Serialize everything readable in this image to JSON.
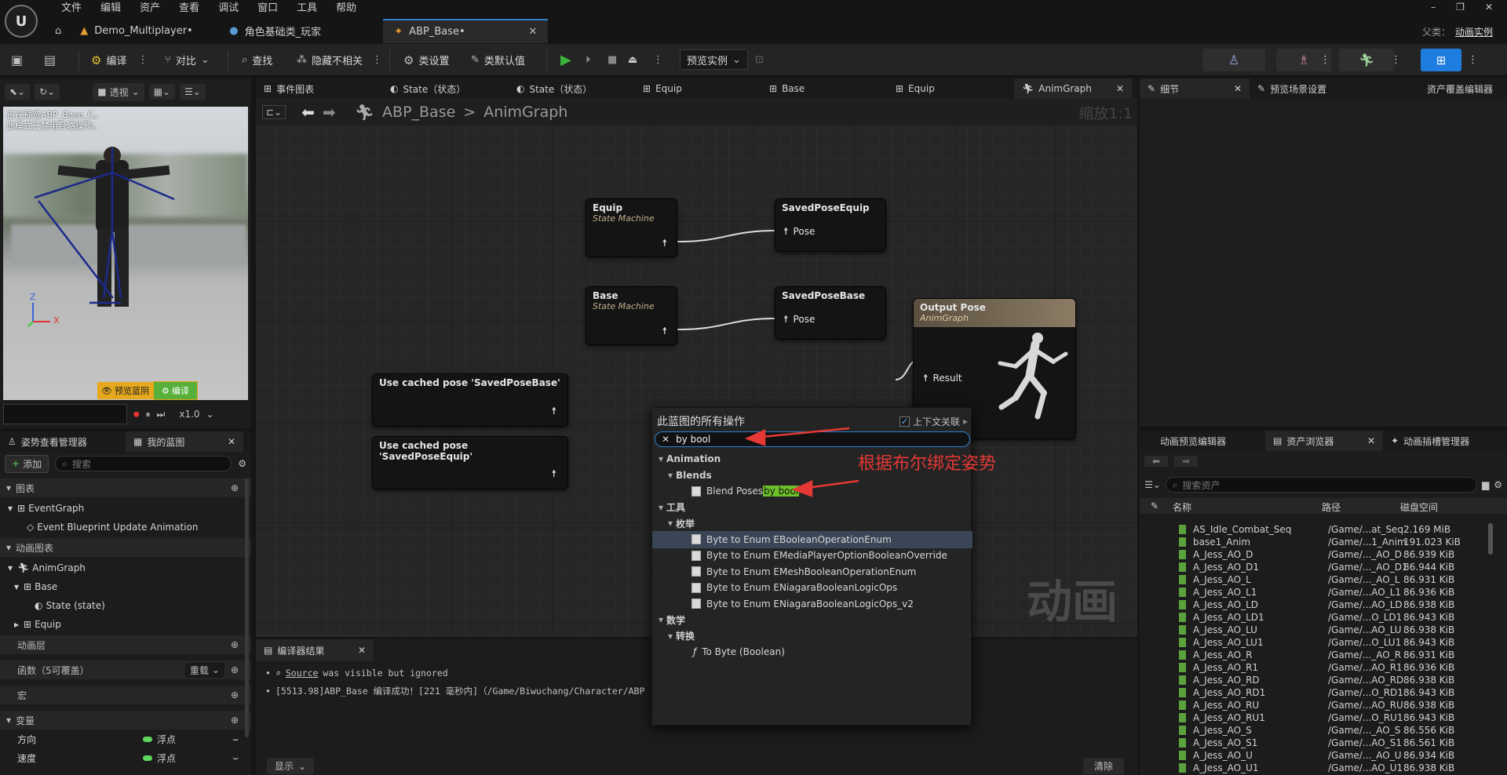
{
  "menu": [
    "文件",
    "编辑",
    "资产",
    "查看",
    "调试",
    "窗口",
    "工具",
    "帮助"
  ],
  "doc_tabs": [
    {
      "label": "Demo_Multiplayer•"
    },
    {
      "label": "角色基础类_玩家"
    },
    {
      "label": "ABP_Base•"
    }
  ],
  "top_right": {
    "parent_label": "父类：",
    "parent_value": "动画实例"
  },
  "toolbar": {
    "compile": "编译",
    "diff": "对比",
    "find": "查找",
    "hide_unrelated": "隐藏不相关",
    "class_settings": "类设置",
    "class_defaults": "类默认值",
    "preview_instance": "预览实例"
  },
  "viewport": {
    "mode": "透视",
    "notice_line1": "正在预览ABP_Base_C。",
    "notice_line2": "此模式已禁用骨骼操作。",
    "preview_btn": "预览蓝阴",
    "compile_btn": "编译",
    "speed": "x1.0",
    "axis_z": "Z",
    "axis_x": "X"
  },
  "left_tabs": {
    "pose_watch": "姿势查看管理器",
    "my_blueprint": "我的蓝图"
  },
  "my_bp": {
    "add": "添加",
    "search_placeholder": "搜索",
    "graphs": "图表",
    "event_graph": "EventGraph",
    "event_update": "Event Blueprint Update Animation",
    "anim_graphs": "动画图表",
    "anim_graph": "AnimGraph",
    "base": "Base",
    "state": "State (state)",
    "equip": "Equip",
    "anim_layers": "动画层",
    "functions": "函数（5可覆盖）",
    "override": "重载",
    "macros": "宏",
    "variables": "变量",
    "var1": "方向",
    "var2": "速度",
    "var_type": "浮点"
  },
  "graph_tabs": [
    {
      "label": "事件图表"
    },
    {
      "label": "State（状态）"
    },
    {
      "label": "State（状态）"
    },
    {
      "label": "Equip"
    },
    {
      "label": "Base"
    },
    {
      "label": "Equip"
    },
    {
      "label": "AnimGraph"
    }
  ],
  "breadcrumb": {
    "root": "ABP_Base",
    "sep": ">",
    "leaf": "AnimGraph",
    "zoom": "缩放1:1"
  },
  "nodes": {
    "equip_title": "Equip",
    "equip_sub": "State Machine",
    "saved_equip": "SavedPoseEquip",
    "pose": "Pose",
    "base_title": "Base",
    "base_sub": "State Machine",
    "saved_base": "SavedPoseBase",
    "output_title": "Output Pose",
    "output_sub": "AnimGraph",
    "result": "Result",
    "cached_base": "Use cached pose 'SavedPoseBase'",
    "cached_equip": "Use cached pose 'SavedPoseEquip'"
  },
  "watermark": "动画",
  "popup": {
    "title": "此蓝图的所有操作",
    "context": "上下文关联",
    "search_value": "by bool",
    "annotation": "根据布尔绑定姿势",
    "items": [
      {
        "label": "Animation",
        "indent": 0,
        "type": "hdr"
      },
      {
        "label": "Blends",
        "indent": 1,
        "type": "hdr"
      },
      {
        "label": "Blend Poses ",
        "hl": "by bool",
        "indent": 2,
        "type": "item"
      },
      {
        "label": "工具",
        "indent": 0,
        "type": "hdr"
      },
      {
        "label": "枚举",
        "indent": 1,
        "type": "hdr"
      },
      {
        "label": "Byte to Enum EBooleanOperationEnum",
        "indent": 2,
        "type": "item",
        "selected": true
      },
      {
        "label": "Byte to Enum EMediaPlayerOptionBooleanOverride",
        "indent": 2,
        "type": "item"
      },
      {
        "label": "Byte to Enum EMeshBooleanOperationEnum",
        "indent": 2,
        "type": "item"
      },
      {
        "label": "Byte to Enum ENiagaraBooleanLogicOps",
        "indent": 2,
        "type": "item"
      },
      {
        "label": "Byte to Enum ENiagaraBooleanLogicOps_v2",
        "indent": 2,
        "type": "item"
      },
      {
        "label": "数学",
        "indent": 0,
        "type": "hdr"
      },
      {
        "label": "转换",
        "indent": 1,
        "type": "hdr"
      },
      {
        "label": "To Byte (Boolean)",
        "indent": 2,
        "type": "func"
      }
    ]
  },
  "compiler": {
    "tab": "编译器结果",
    "line1_link": "Source",
    "line1_rest": " was visible but ignored",
    "line2": "[5513.98]ABP_Base 编译成功！[221 毫秒内]（/Game/Biwuchang/Character/ABP",
    "show": "显示",
    "clear": "清除"
  },
  "right_tabs": {
    "details": "细节",
    "preview_scene": "预览场景设置",
    "asset_override": "资产覆盖编辑器"
  },
  "bottom_right_tabs": {
    "anim_preview": "动画预览编辑器",
    "asset_browser": "资产浏览器",
    "anim_slots": "动画插槽管理器"
  },
  "asset_browser": {
    "search_placeholder": "搜索资产",
    "col_name": "名称",
    "col_path": "路径",
    "col_size": "磁盘空间",
    "rows": [
      [
        "AS_Idle_Combat_Seq",
        "/Game/...at_Seq",
        "2.169 MiB"
      ],
      [
        "base1_Anim",
        "/Game/...1_Anim",
        "191.023 KiB"
      ],
      [
        "A_Jess_AO_D",
        "/Game/..._AO_D",
        "86.939 KiB"
      ],
      [
        "A_Jess_AO_D1",
        "/Game/..._AO_D1",
        "86.944 KiB"
      ],
      [
        "A_Jess_AO_L",
        "/Game/..._AO_L",
        "86.931 KiB"
      ],
      [
        "A_Jess_AO_L1",
        "/Game/...AO_L1",
        "86.936 KiB"
      ],
      [
        "A_Jess_AO_LD",
        "/Game/...AO_LD",
        "86.938 KiB"
      ],
      [
        "A_Jess_AO_LD1",
        "/Game/...O_LD1",
        "86.943 KiB"
      ],
      [
        "A_Jess_AO_LU",
        "/Game/...AO_LU",
        "86.938 KiB"
      ],
      [
        "A_Jess_AO_LU1",
        "/Game/...O_LU1",
        "86.943 KiB"
      ],
      [
        "A_Jess_AO_R",
        "/Game/..._AO_R",
        "86.931 KiB"
      ],
      [
        "A_Jess_AO_R1",
        "/Game/...AO_R1",
        "86.936 KiB"
      ],
      [
        "A_Jess_AO_RD",
        "/Game/...AO_RD",
        "86.938 KiB"
      ],
      [
        "A_Jess_AO_RD1",
        "/Game/...O_RD1",
        "86.943 KiB"
      ],
      [
        "A_Jess_AO_RU",
        "/Game/...AO_RU",
        "86.938 KiB"
      ],
      [
        "A_Jess_AO_RU1",
        "/Game/...O_RU1",
        "86.943 KiB"
      ],
      [
        "A_Jess_AO_S",
        "/Game/..._AO_S",
        "86.556 KiB"
      ],
      [
        "A_Jess_AO_S1",
        "/Game/...AO_S1",
        "86.561 KiB"
      ],
      [
        "A_Jess_AO_U",
        "/Game/..._AO_U",
        "86.934 KiB"
      ],
      [
        "A_Jess_AO_U1",
        "/Game/...AO_U1",
        "86.938 KiB"
      ]
    ]
  },
  "colors": {
    "accent": "#2f7fd1",
    "red_annotation": "#e53935",
    "play_green": "#3cb43c",
    "highlight": "#6ec02a"
  }
}
